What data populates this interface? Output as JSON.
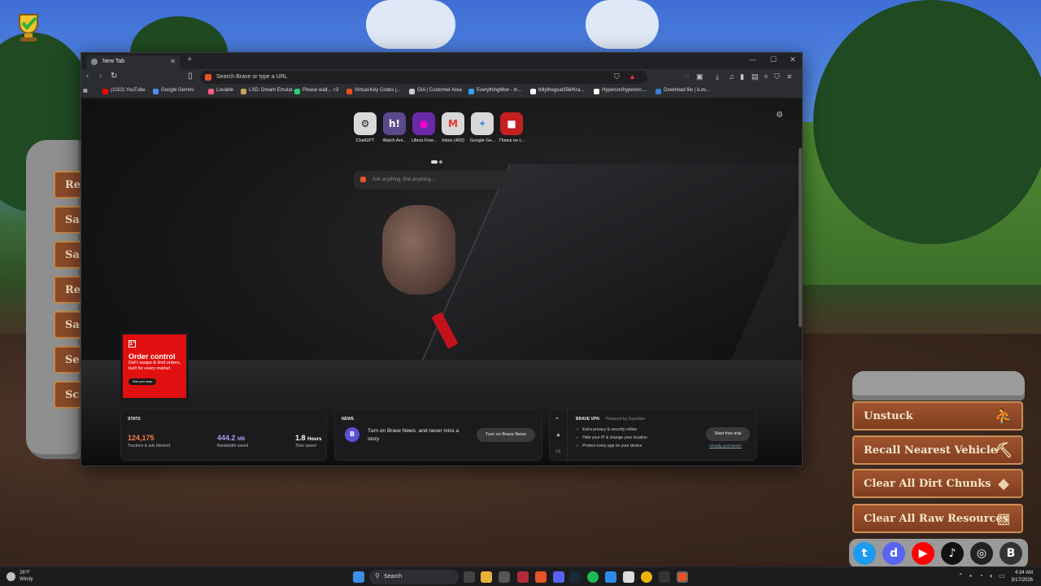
{
  "browser": {
    "tab_title": "New Tab",
    "url_placeholder": "Search Brave or type a URL",
    "bookmarks": [
      {
        "label": "(1022) YouTube",
        "color": "#ff0000"
      },
      {
        "label": "Google Gemini",
        "color": "#4f8cf7"
      },
      {
        "label": "Lovable",
        "color": "#ff5a8a"
      },
      {
        "label": "LSD: Dream Emulat...",
        "color": "#c9a35a"
      },
      {
        "label": "Please wait... <3",
        "color": "#2ecc71"
      },
      {
        "label": "Virtual-Key Codes (...",
        "color": "#f25022"
      },
      {
        "label": "GIA | Customer Area",
        "color": "#cccccc"
      },
      {
        "label": "EverythingMoe - In...",
        "color": "#3aa0ff"
      },
      {
        "label": "billythegoat356/Kra...",
        "color": "#ffffff"
      },
      {
        "label": "Hyperion/hyperion....",
        "color": "#ffffff"
      },
      {
        "label": "Download file | iLov...",
        "color": "#3a7bd5"
      }
    ]
  },
  "new_tab": {
    "top_sites": [
      {
        "label": "ChatGPT",
        "glyph": "⚙"
      },
      {
        "label": "Watch Ani...",
        "glyph": "h!"
      },
      {
        "label": "Ultros Free...",
        "glyph": "●"
      },
      {
        "label": "Inbox (403)",
        "glyph": "M"
      },
      {
        "label": "Google Ge...",
        "glyph": "✦"
      },
      {
        "label": "Поиск по с...",
        "glyph": "■"
      }
    ],
    "search_placeholder": "Ask anything, find anything...",
    "ad": {
      "logo": "1\"",
      "title": "Order control",
      "body": "DeFi swaps & limit orders, built for every market",
      "cta": "Start your swap"
    },
    "stats": {
      "heading": "STATS",
      "trackers_value": "124,175",
      "trackers_label": "Trackers & ads blocked",
      "bandwidth_value": "444.2",
      "bandwidth_unit": "MB",
      "bandwidth_label": "Bandwidth saved",
      "time_value": "1.8",
      "time_unit": "Hours",
      "time_label": "Time saved"
    },
    "news": {
      "heading": "NEWS",
      "text": "Turn on Brave News, and never miss a story",
      "button": "Turn on Brave News"
    },
    "vpn": {
      "title": "BRAVE VPN",
      "powered": "Powered by Guardian",
      "features": [
        "Extra privacy & security online",
        "Hide your IP & change your location",
        "Protect every app on your device"
      ],
      "button": "Start free trial",
      "already": "Already purchased?"
    }
  },
  "game": {
    "left_buttons": [
      "Re",
      "Sa",
      "Sa",
      "Re",
      "Sa",
      "Se",
      "Sc"
    ],
    "right_buttons": [
      {
        "label": "Unstuck",
        "icon": "⛹"
      },
      {
        "label": "Recall Nearest Vehicle",
        "icon": "⛏"
      },
      {
        "label": "Clear All Dirt Chunks",
        "icon": "◆"
      },
      {
        "label": "Clear All Raw Resources",
        "icon": "▧"
      }
    ],
    "socials": [
      {
        "name": "twitter",
        "color": "#1d9bf0",
        "glyph": "t"
      },
      {
        "name": "discord",
        "color": "#5865f2",
        "glyph": "d"
      },
      {
        "name": "youtube",
        "color": "#ff0000",
        "glyph": "▶"
      },
      {
        "name": "tiktok",
        "color": "#111111",
        "glyph": "♪"
      },
      {
        "name": "instagram",
        "color": "#222222",
        "glyph": "◎"
      },
      {
        "name": "brand",
        "color": "#333333",
        "glyph": "B"
      }
    ]
  },
  "taskbar": {
    "temperature": "26°F",
    "weather": "Windy",
    "search": "Search",
    "time": "4:34 AM",
    "date": "3/17/2026"
  }
}
